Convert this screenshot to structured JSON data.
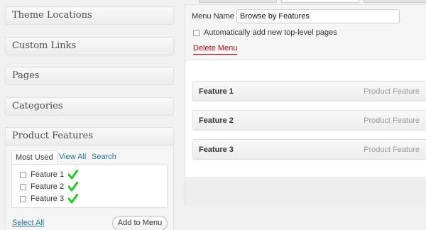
{
  "sidebar": {
    "boxes": [
      {
        "title": "Theme Locations"
      },
      {
        "title": "Custom Links"
      },
      {
        "title": "Pages"
      },
      {
        "title": "Categories"
      }
    ],
    "product_features": {
      "title": "Product Features",
      "tabs": [
        {
          "label": "Most Used",
          "active": true
        },
        {
          "label": "View All",
          "active": false
        },
        {
          "label": "Search",
          "active": false
        }
      ],
      "items": [
        {
          "label": "Feature 1",
          "checked": false
        },
        {
          "label": "Feature 2",
          "checked": false
        },
        {
          "label": "Feature 3",
          "checked": false
        }
      ],
      "select_all": "Select All",
      "add_button": "Add to Menu"
    }
  },
  "menu_editor": {
    "name_label": "Menu Name",
    "name_value": "Browse by Features",
    "auto_add_label": "Automatically add new top-level pages",
    "auto_add_checked": false,
    "delete_label": "Delete Menu",
    "items": [
      {
        "title": "Feature 1",
        "type": "Product Feature"
      },
      {
        "title": "Feature 2",
        "type": "Product Feature"
      },
      {
        "title": "Feature 3",
        "type": "Product Feature"
      }
    ]
  },
  "colors": {
    "link": "#21759b",
    "delete": "#bc0b0b",
    "checkmark": "#22cc22"
  }
}
